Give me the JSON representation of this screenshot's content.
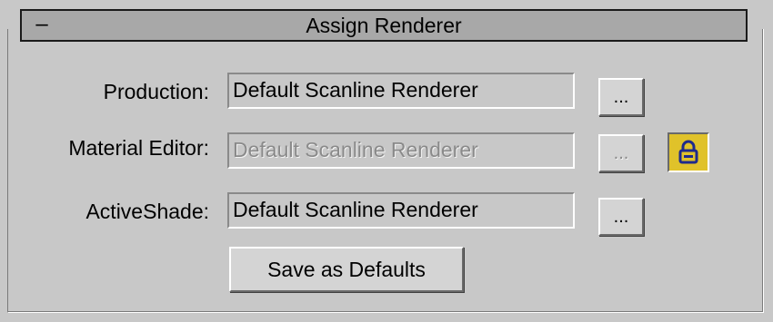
{
  "rollout": {
    "title": "Assign Renderer",
    "collapse_symbol": "–"
  },
  "rows": [
    {
      "label": "Production:",
      "value": "Default Scanline Renderer",
      "button": "...",
      "enabled": true
    },
    {
      "label": "Material Editor:",
      "value": "Default Scanline Renderer",
      "button": "...",
      "enabled": false,
      "lock_icon": "lock-icon"
    },
    {
      "label": "ActiveShade:",
      "value": "Default Scanline Renderer",
      "button": "...",
      "enabled": true
    }
  ],
  "save_button": {
    "label": "Save as Defaults"
  },
  "colors": {
    "panel_bg": "#c8c8c8",
    "header_bg": "#a8a8a8",
    "lock_active": "#e0c22a",
    "lock_glyph": "#1e2a8c",
    "disabled_text": "#8a8a8a"
  }
}
